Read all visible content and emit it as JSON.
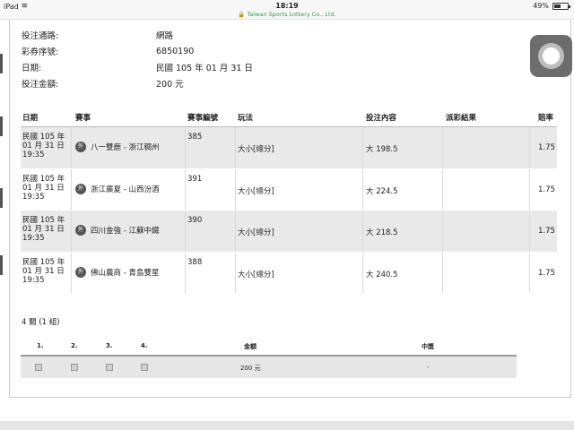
{
  "status": {
    "device": "iPad",
    "time": "18:19",
    "site": "🔒 Taiwan Sports Lottery Co., Ltd.",
    "battery": "49%",
    "battery_level": 0.49
  },
  "info": [
    {
      "label": "投注通路:",
      "value": "網路"
    },
    {
      "label": "彩券序號:",
      "value": "6850190"
    },
    {
      "label": "日期:",
      "value": "民國 105 年 01 月 31 日"
    },
    {
      "label": "投注金額:",
      "value": "200 元"
    }
  ],
  "bets": {
    "headers": {
      "date": "日期",
      "event": "賽事",
      "event_no": "賽事編號",
      "play": "玩法",
      "content": "投注內容",
      "result": "派彩結果",
      "odds": "賠率"
    },
    "rows": [
      {
        "date": [
          "民國 105 年",
          "01 月 31 日",
          "19:35"
        ],
        "badge": "外",
        "match": "八一雙鹿 - 浙江稠州",
        "event_no": "385",
        "play": "大小[總分]",
        "content": "大 198.5",
        "result": "",
        "odds": "1.75"
      },
      {
        "date": [
          "民國 105 年",
          "01 月 31 日",
          "19:35"
        ],
        "badge": "外",
        "match": "浙江廣夏 - 山西汾酒",
        "event_no": "391",
        "play": "大小[總分]",
        "content": "大 224.5",
        "result": "",
        "odds": "1.75"
      },
      {
        "date": [
          "民國 105 年",
          "01 月 31 日",
          "19:35"
        ],
        "badge": "外",
        "match": "四川金強 - 江蘇中鐵",
        "event_no": "390",
        "play": "大小[總分]",
        "content": "大 218.5",
        "result": "",
        "odds": "1.75"
      },
      {
        "date": [
          "民國 105 年",
          "01 月 31 日",
          "19:35"
        ],
        "badge": "外",
        "match": "佛山農商 - 青島雙星",
        "event_no": "388",
        "play": "大小[總分]",
        "content": "大 240.5",
        "result": "",
        "odds": "1.75"
      }
    ]
  },
  "passes": "4 關 (1 組)",
  "combo": {
    "headers": {
      "c1": "1.",
      "c2": "2.",
      "c3": "3.",
      "c4": "4.",
      "amount": "金額",
      "prize": "中獎"
    },
    "row": {
      "amount": "200 元",
      "prize": "-"
    }
  }
}
